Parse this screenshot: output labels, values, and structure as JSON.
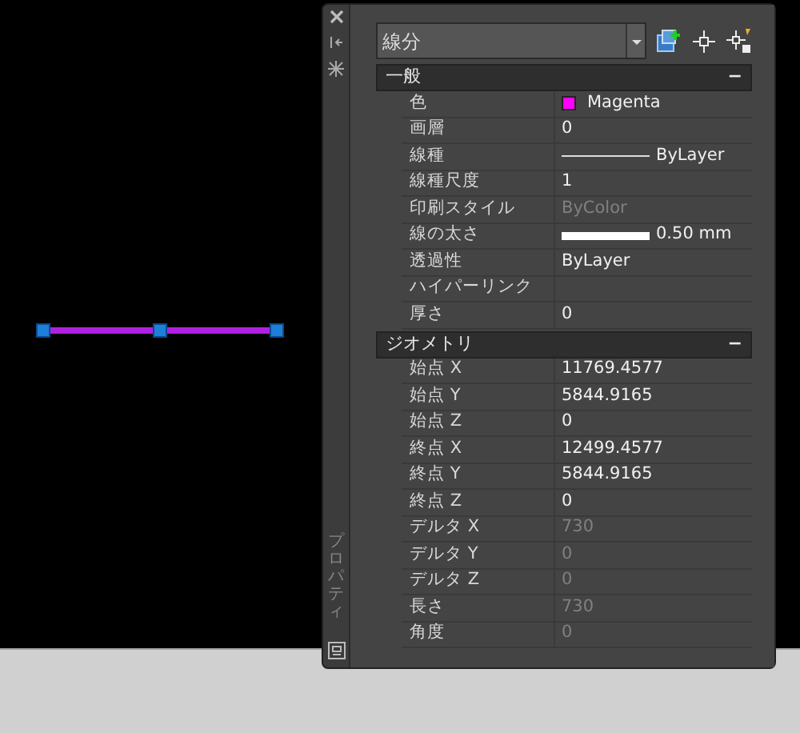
{
  "palette": {
    "title": "プロパティ",
    "object_type": "線分",
    "sections": [
      {
        "title": "一般",
        "toggle": "−",
        "rows": [
          {
            "label": "色",
            "value": "Magenta",
            "kind": "color",
            "color": "#ff00ff",
            "disabled": false
          },
          {
            "label": "画層",
            "value": "0",
            "kind": "text",
            "disabled": false
          },
          {
            "label": "線種",
            "value": "ByLayer",
            "kind": "linetype",
            "disabled": false
          },
          {
            "label": "線種尺度",
            "value": "1",
            "kind": "text",
            "disabled": false
          },
          {
            "label": "印刷スタイル",
            "value": "ByColor",
            "kind": "text",
            "disabled": true
          },
          {
            "label": "線の太さ",
            "value": "0.50 mm",
            "kind": "lineweight",
            "disabled": false
          },
          {
            "label": "透過性",
            "value": "ByLayer",
            "kind": "text",
            "disabled": false
          },
          {
            "label": "ハイパーリンク",
            "kind": "text"
          },
          {
            "label": "厚さ",
            "value": "0",
            "kind": "text",
            "disabled": false
          }
        ]
      },
      {
        "title": "ジオメトリ",
        "toggle": "−",
        "rows": [
          {
            "label": "始点 X",
            "value": "11769.4577",
            "kind": "text",
            "disabled": false
          },
          {
            "label": "始点 Y",
            "value": "5844.9165",
            "kind": "text",
            "disabled": false
          },
          {
            "label": "始点 Z",
            "value": "0",
            "kind": "text",
            "disabled": false
          },
          {
            "label": "終点 X",
            "value": "12499.4577",
            "kind": "text",
            "disabled": false
          },
          {
            "label": "終点 Y",
            "value": "5844.9165",
            "kind": "text",
            "disabled": false
          },
          {
            "label": "終点 Z",
            "value": "0",
            "kind": "text",
            "disabled": false
          },
          {
            "label": "デルタ X",
            "value": "730",
            "kind": "text",
            "disabled": true
          },
          {
            "label": "デルタ Y",
            "value": "0",
            "kind": "text",
            "disabled": true
          },
          {
            "label": "デルタ Z",
            "value": "0",
            "kind": "text",
            "disabled": true
          },
          {
            "label": "長さ",
            "value": "730",
            "kind": "text",
            "disabled": true
          },
          {
            "label": "角度",
            "value": "0",
            "kind": "text",
            "disabled": true
          }
        ]
      }
    ]
  }
}
